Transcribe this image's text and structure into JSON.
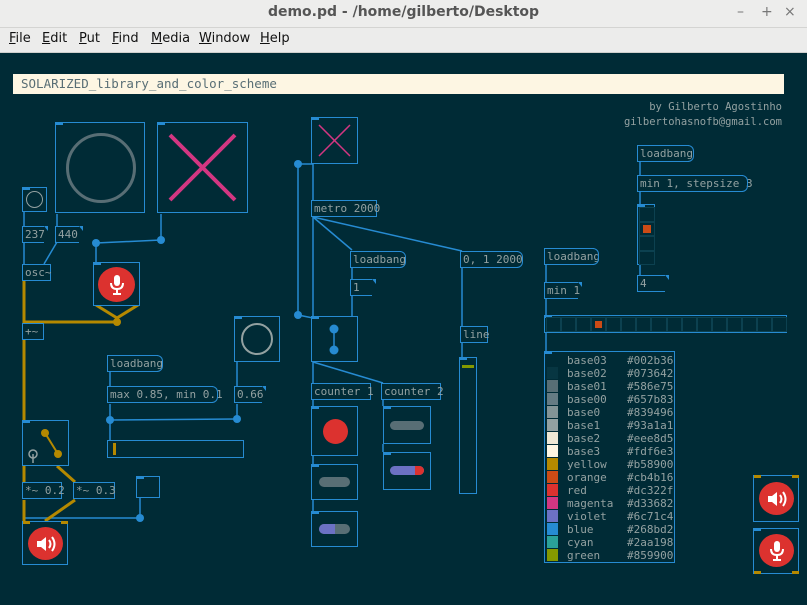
{
  "window": {
    "title": "demo.pd  - /home/gilberto/Desktop",
    "controls": [
      "–",
      "+",
      "×"
    ]
  },
  "menu": [
    {
      "label": "File",
      "key": "F",
      "rest": "ile"
    },
    {
      "label": "Edit",
      "key": "E",
      "rest": "dit"
    },
    {
      "label": "Put",
      "key": "P",
      "rest": "ut"
    },
    {
      "label": "Find",
      "key": "F",
      "rest": "ind"
    },
    {
      "label": "Media",
      "key": "M",
      "rest": "edia"
    },
    {
      "label": "Window",
      "key": "W",
      "rest": "indow"
    },
    {
      "label": "Help",
      "key": "H",
      "rest": "elp"
    }
  ],
  "header": {
    "comment": "SOLARIZED_library_and_color_scheme"
  },
  "credits": {
    "author": "by Gilberto Agostinho",
    "email": "gilbertohasnofb@gmail.com"
  },
  "objects": {
    "osc": "osc~",
    "plus": "+~",
    "mul1": "*~ 0.2",
    "mul2": "*~ 0.3",
    "metro": "metro 2000",
    "line": "line",
    "min1": "min 1",
    "counter1": "counter 1",
    "counter2": "counter 2"
  },
  "messages": {
    "loadbang_a": "loadbang",
    "loadbang_b": "loadbang",
    "loadbang_c": "loadbang",
    "loadbang_d": "loadbang",
    "range_msg": "max 0.85, min 0.1",
    "ramp_msg": "0, 1 2000",
    "stepsize_msg": "min 1, stepsize 3"
  },
  "numbers": {
    "freq1": "237",
    "freq2": "440",
    "one": "1",
    "volume": "0.66",
    "four": "4"
  },
  "levels": {
    "hslider": 0.02,
    "vslider": 0.04,
    "hradio_selected": 3,
    "vradio_selected": 1
  },
  "palette": [
    {
      "name": "base03",
      "hex": "#002b36"
    },
    {
      "name": "base02",
      "hex": "#073642"
    },
    {
      "name": "base01",
      "hex": "#586e75"
    },
    {
      "name": "base00",
      "hex": "#657b83"
    },
    {
      "name": "base0",
      "hex": "#839496"
    },
    {
      "name": "base1",
      "hex": "#93a1a1"
    },
    {
      "name": "base2",
      "hex": "#eee8d5"
    },
    {
      "name": "base3",
      "hex": "#fdf6e3"
    },
    {
      "name": "yellow",
      "hex": "#b58900"
    },
    {
      "name": "orange",
      "hex": "#cb4b16"
    },
    {
      "name": "red",
      "hex": "#dc322f"
    },
    {
      "name": "magenta",
      "hex": "#d33682"
    },
    {
      "name": "violet",
      "hex": "#6c71c4"
    },
    {
      "name": "blue",
      "hex": "#268bd2"
    },
    {
      "name": "cyan",
      "hex": "#2aa198"
    },
    {
      "name": "green",
      "hex": "#859900"
    }
  ],
  "colors": {
    "canvas": "#002b36",
    "wire_control": "#268bd2",
    "wire_audio": "#b58900",
    "accent": "#dc322f",
    "frame": "#268bd2"
  }
}
